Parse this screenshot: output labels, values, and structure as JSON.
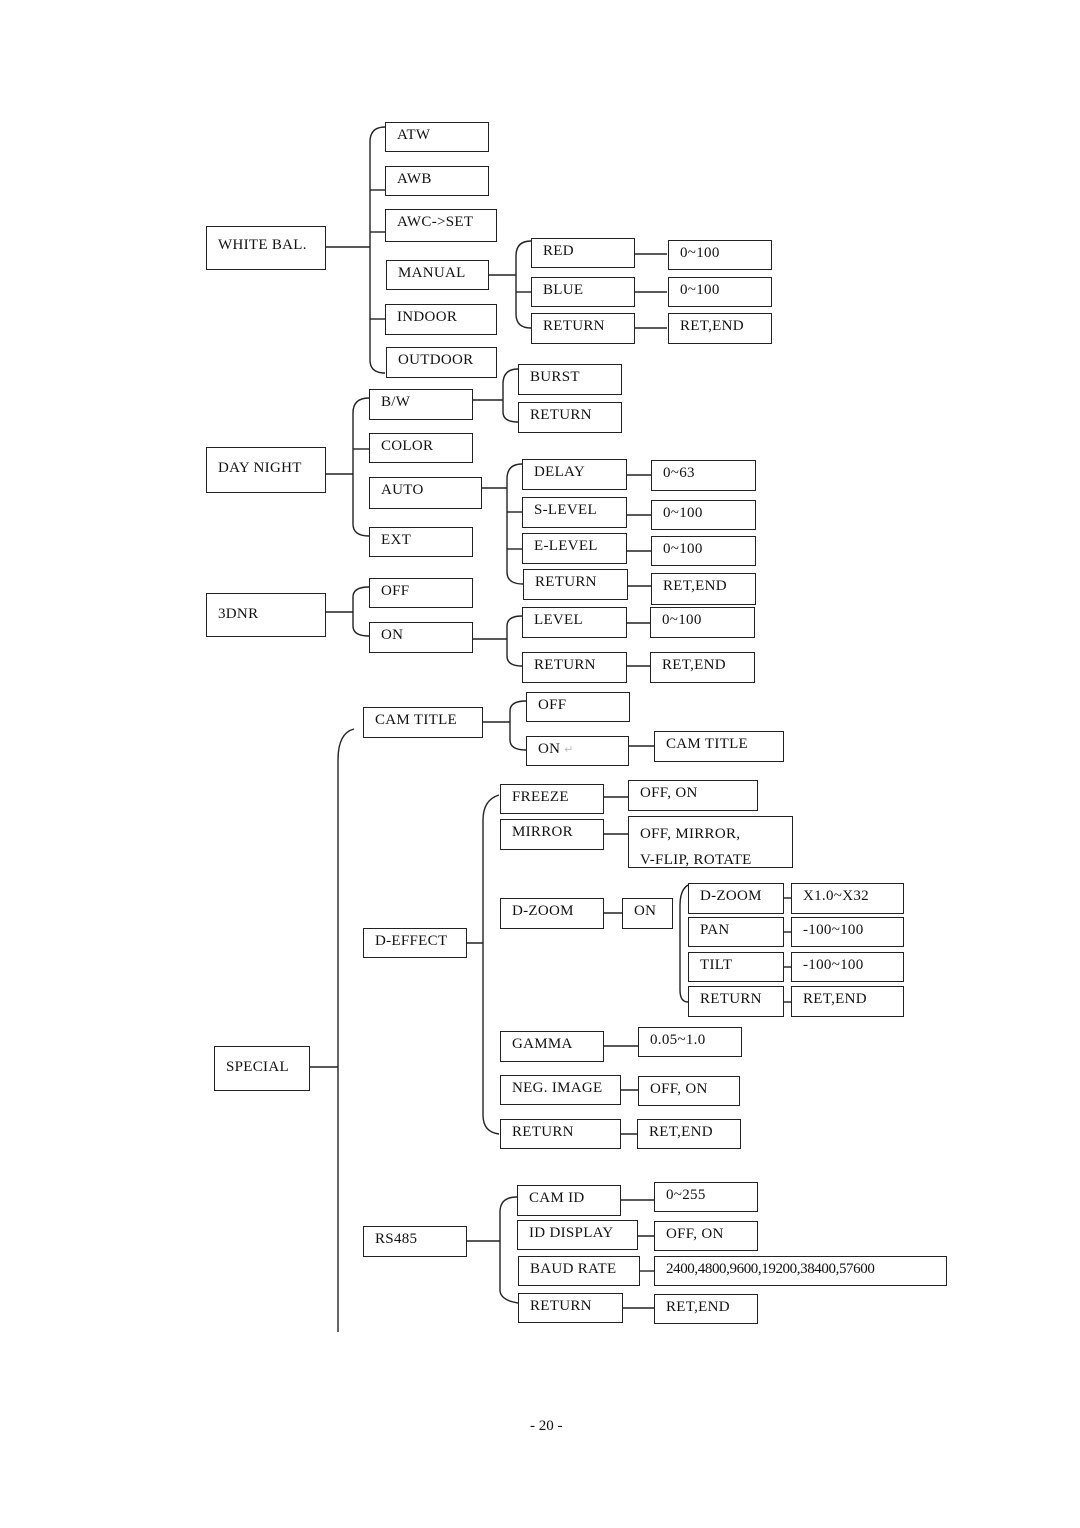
{
  "diagram": {
    "white_bal": {
      "label": "WHITE BAL.",
      "options": [
        "ATW",
        "AWB",
        "AWC->SET",
        "MANUAL",
        "INDOOR",
        "OUTDOOR"
      ],
      "manual": {
        "items": [
          "RED",
          "BLUE",
          "RETURN"
        ],
        "values": [
          "0~100",
          "0~100",
          "RET,END"
        ]
      }
    },
    "day_night": {
      "label": "DAY NIGHT",
      "options": [
        "B/W",
        "COLOR",
        "AUTO",
        "EXT"
      ],
      "bw": {
        "items": [
          "BURST",
          "RETURN"
        ]
      },
      "auto": {
        "items": [
          "DELAY",
          "S-LEVEL",
          "E-LEVEL",
          "RETURN"
        ],
        "values": [
          "0~63",
          "0~100",
          "0~100",
          "RET,END"
        ]
      }
    },
    "dnr": {
      "label": "3DNR",
      "options": [
        "OFF",
        "ON"
      ],
      "on": {
        "items": [
          "LEVEL",
          "RETURN"
        ],
        "values": [
          "0~100",
          "RET,END"
        ]
      }
    },
    "special": {
      "label": "SPECIAL",
      "cam_title": {
        "label": "CAM TITLE",
        "options": [
          "OFF",
          "ON"
        ],
        "on_arrow": "↵",
        "on_value": "CAM TITLE"
      },
      "d_effect": {
        "label": "D-EFFECT",
        "freeze": {
          "label": "FREEZE",
          "value": "OFF, ON"
        },
        "mirror": {
          "label": "MIRROR",
          "value_line1": "OFF, MIRROR,",
          "value_line2": "V-FLIP, ROTATE"
        },
        "dzoom": {
          "label": "D-ZOOM",
          "on": "ON",
          "items": [
            "D-ZOOM",
            "PAN",
            "TILT",
            "RETURN"
          ],
          "values": [
            "X1.0~X32",
            "-100~100",
            "-100~100",
            "RET,END"
          ]
        },
        "gamma": {
          "label": "GAMMA",
          "value": "0.05~1.0"
        },
        "neg_image": {
          "label": "NEG. IMAGE",
          "value": "OFF, ON"
        },
        "return": {
          "label": "RETURN",
          "value": "RET,END"
        }
      },
      "rs485": {
        "label": "RS485",
        "items": [
          "CAM ID",
          "ID DISPLAY",
          "BAUD RATE",
          "RETURN"
        ],
        "values": [
          "0~255",
          "OFF, ON",
          "2400,4800,9600,19200,38400,57600",
          "RET,END"
        ]
      }
    }
  },
  "page_number": "- 20 -"
}
